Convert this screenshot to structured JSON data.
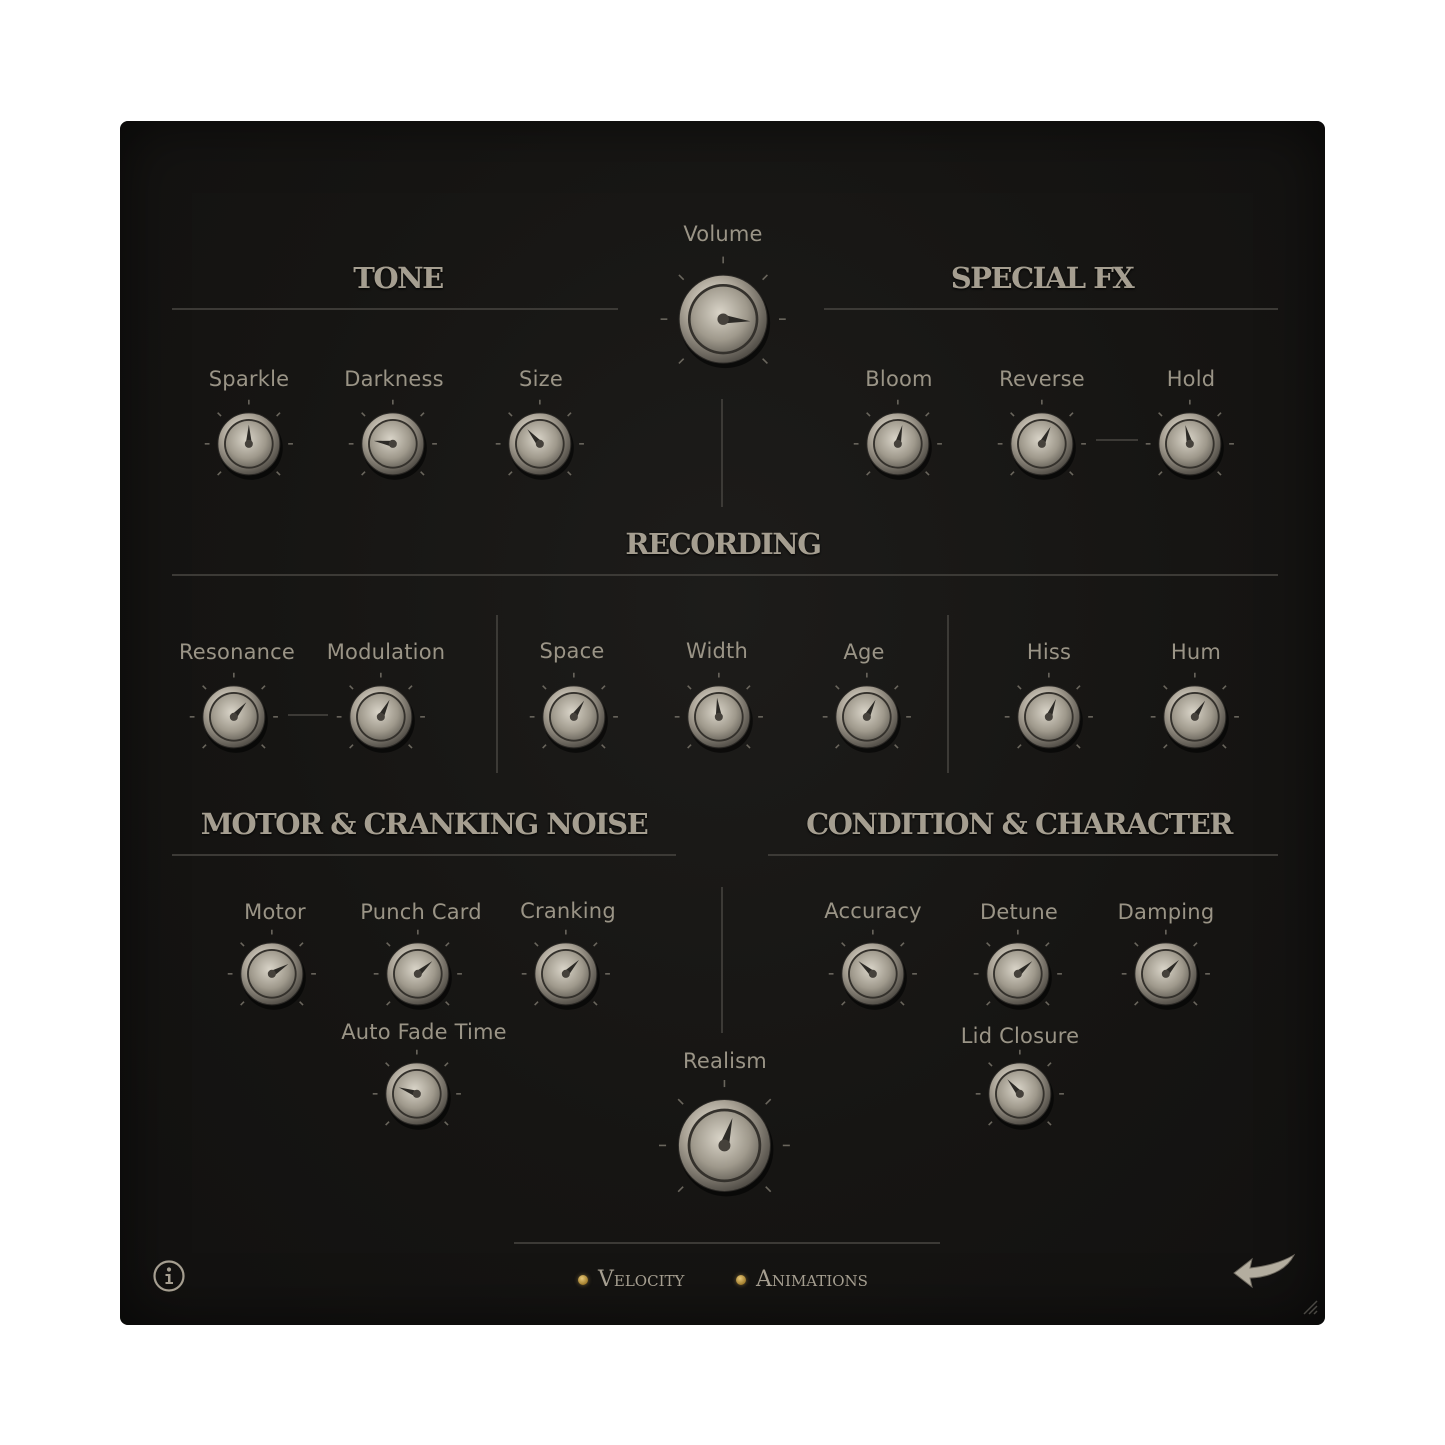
{
  "sections": {
    "tone": "TONE",
    "special_fx": "SPECIAL FX",
    "recording": "RECORDING",
    "motor": "MOTOR & CRANKING NOISE",
    "condition": "CONDITION & CHARACTER"
  },
  "knobs": {
    "volume": {
      "label": "Volume",
      "value": 0.85
    },
    "sparkle": {
      "label": "Sparkle",
      "value": 0.5
    },
    "darkness": {
      "label": "Darkness",
      "value": 0.2
    },
    "size": {
      "label": "Size",
      "value": 0.35
    },
    "bloom": {
      "label": "Bloom",
      "value": 0.55
    },
    "reverse": {
      "label": "Reverse",
      "value": 0.6
    },
    "hold": {
      "label": "Hold",
      "value": 0.45
    },
    "resonance": {
      "label": "Resonance",
      "value": 0.65
    },
    "modulation": {
      "label": "Modulation",
      "value": 0.6
    },
    "space": {
      "label": "Space",
      "value": 0.62
    },
    "width": {
      "label": "Width",
      "value": 0.48
    },
    "age": {
      "label": "Age",
      "value": 0.6
    },
    "hiss": {
      "label": "Hiss",
      "value": 0.58
    },
    "hum": {
      "label": "Hum",
      "value": 0.62
    },
    "motor": {
      "label": "Motor",
      "value": 0.72
    },
    "punch_card": {
      "label": "Punch Card",
      "value": 0.68
    },
    "cranking": {
      "label": "Cranking",
      "value": 0.66
    },
    "auto_fade": {
      "label": "Auto Fade Time",
      "value": 0.24
    },
    "realism": {
      "label": "Realism",
      "value": 0.56
    },
    "accuracy": {
      "label": "Accuracy",
      "value": 0.32
    },
    "detune": {
      "label": "Detune",
      "value": 0.68
    },
    "damping": {
      "label": "Damping",
      "value": 0.66
    },
    "lid_closure": {
      "label": "Lid Closure",
      "value": 0.35
    }
  },
  "footer": {
    "velocity": "Velocity",
    "animations": "Animations"
  },
  "icons": {
    "info": "info-icon",
    "back": "back-arrow-icon"
  },
  "colors": {
    "panel": "#161513",
    "text": "#a59e90",
    "line": "#3c3a36",
    "led": "#c9a450"
  }
}
